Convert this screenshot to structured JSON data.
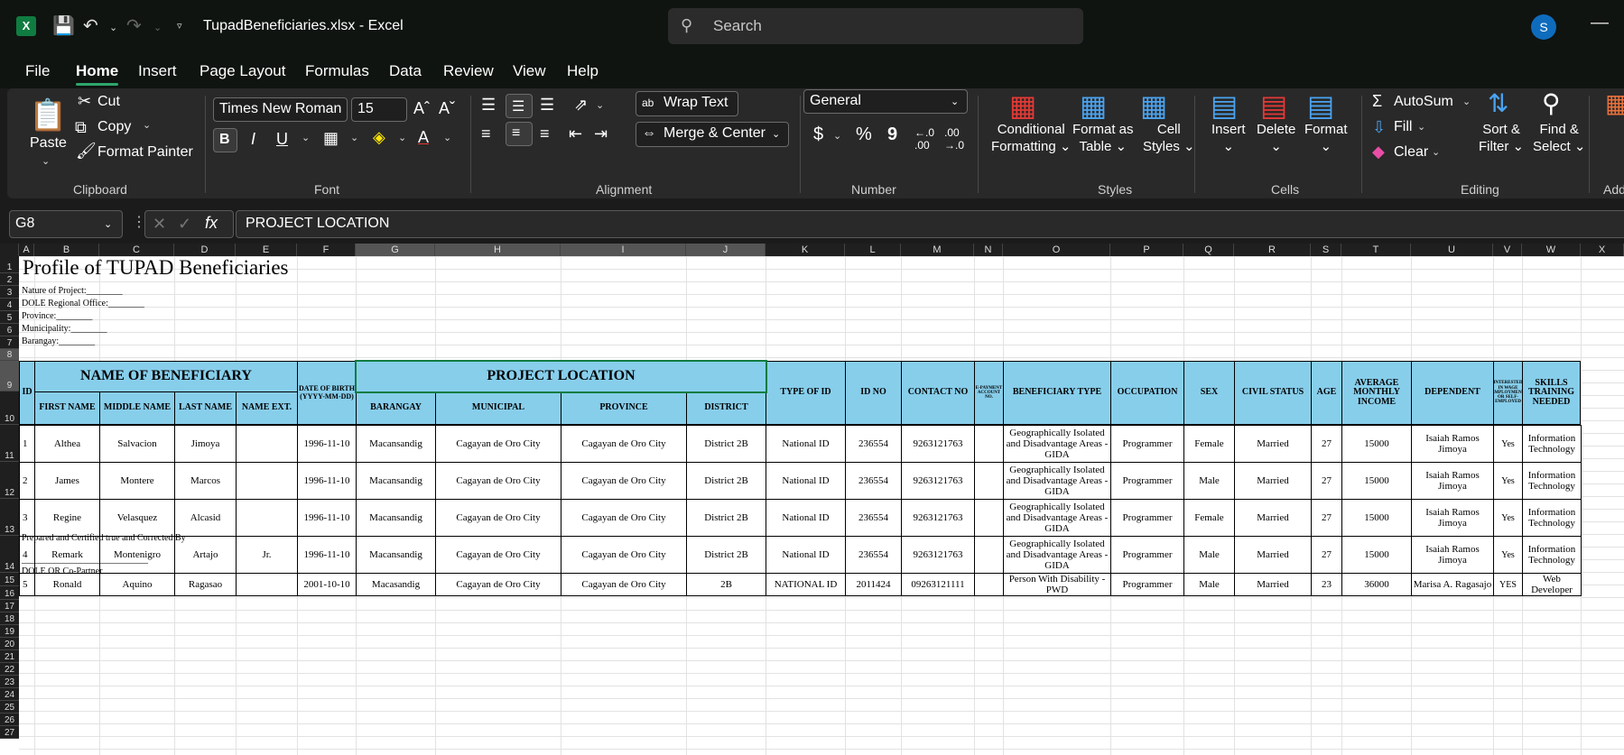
{
  "app": {
    "logo": "X",
    "doc_title": "TupadBeneficiaries.xlsx  -  Excel",
    "search_placeholder": "Search",
    "avatar": "S"
  },
  "menu": [
    "File",
    "Home",
    "Insert",
    "Page Layout",
    "Formulas",
    "Data",
    "Review",
    "View",
    "Help"
  ],
  "ribbon": {
    "clipboard": {
      "paste": "Paste",
      "cut": "Cut",
      "copy": "Copy",
      "format_painter": "Format Painter",
      "label": "Clipboard"
    },
    "font": {
      "name": "Times New Roman",
      "size": "15",
      "bold": "B",
      "italic": "I",
      "underline": "U",
      "label": "Font"
    },
    "alignment": {
      "wrap": "Wrap Text",
      "merge": "Merge & Center",
      "label": "Alignment"
    },
    "number": {
      "format": "General",
      "currency": "$",
      "percent": "%",
      "comma": "9",
      "label": "Number"
    },
    "styles": {
      "conditional": [
        "Conditional",
        "Formatting"
      ],
      "format_table": [
        "Format as",
        "Table"
      ],
      "cell_styles": [
        "Cell",
        "Styles"
      ],
      "label": "Styles"
    },
    "cells": {
      "insert": "Insert",
      "delete": "Delete",
      "format": "Format",
      "label": "Cells"
    },
    "editing": {
      "autosum": "AutoSum",
      "fill": "Fill",
      "clear": "Clear",
      "sort": [
        "Sort &",
        "Filter"
      ],
      "find": [
        "Find &",
        "Select"
      ],
      "label": "Editing"
    },
    "addins": {
      "label": "Add"
    }
  },
  "formula_bar": {
    "name_box": "G8",
    "fx": "fx",
    "content": "PROJECT LOCATION"
  },
  "columns": [
    "A",
    "B",
    "C",
    "D",
    "E",
    "F",
    "G",
    "H",
    "I",
    "J",
    "K",
    "L",
    "M",
    "N",
    "O",
    "P",
    "Q",
    "R",
    "S",
    "T",
    "U",
    "V",
    "W",
    "X"
  ],
  "rows": [
    "1",
    "2",
    "3",
    "4",
    "5",
    "6",
    "7",
    "8",
    "9",
    "10",
    "11",
    "12",
    "13",
    "14",
    "15",
    "16",
    "17",
    "18",
    "19",
    "20",
    "21",
    "22",
    "23",
    "24",
    "25",
    "26",
    "27"
  ],
  "sheet": {
    "title": "Profile of TUPAD Beneficiaries",
    "meta": [
      "Nature of Project:________",
      "DOLE Regional Office:________",
      "Province:________",
      "Municipality:________",
      "Barangay:________"
    ],
    "headers": {
      "id": "ID",
      "name": "NAME OF BENEFICIARY",
      "first": "FIRST NAME",
      "middle": "MIDDLE NAME",
      "last": "LAST NAME",
      "ext": "NAME EXT.",
      "dob": "DATE OF BIRTH (YYYY-MM-DD)",
      "location": "PROJECT LOCATION",
      "barangay": "BARANGAY",
      "municipal": "MUNICIPAL",
      "province": "PROVINCE",
      "district": "DISTRICT",
      "type_id": "TYPE OF ID",
      "id_no": "ID NO",
      "contact": "CONTACT NO",
      "epayment": "E-PAYMENT ACCOUNT NO.",
      "ben_type": "BENEFICIARY TYPE",
      "occupation": "OCCUPATION",
      "sex": "SEX",
      "civil": "CIVIL STATUS",
      "age": "AGE",
      "income": "AVERAGE MONTHLY INCOME",
      "dependent": "DEPENDENT",
      "interest": "INTERESTED IN WAGE EMPLOYMENT OR SELF-EMPLOYED",
      "skills": "SKILLS TRAINING NEEDED"
    },
    "data": [
      [
        "1",
        "Althea",
        "Salvacion",
        "Jimoya",
        "",
        "1996-11-10",
        "Macansandig",
        "Cagayan de Oro City",
        "Cagayan de Oro City",
        "District 2B",
        "National ID",
        "236554",
        "9263121763",
        "",
        "Geographically Isolated and Disadvantage Areas - GIDA",
        "Programmer",
        "Female",
        "Married",
        "27",
        "15000",
        "Isaiah Ramos Jimoya",
        "Yes",
        "Information Technology"
      ],
      [
        "2",
        "James",
        "Montere",
        "Marcos",
        "",
        "1996-11-10",
        "Macansandig",
        "Cagayan de Oro City",
        "Cagayan de Oro City",
        "District 2B",
        "National ID",
        "236554",
        "9263121763",
        "",
        "Geographically Isolated and Disadvantage Areas - GIDA",
        "Programmer",
        "Male",
        "Married",
        "27",
        "15000",
        "Isaiah Ramos Jimoya",
        "Yes",
        "Information Technology"
      ],
      [
        "3",
        "Regine",
        "Velasquez",
        "Alcasid",
        "",
        "1996-11-10",
        "Macansandig",
        "Cagayan de Oro City",
        "Cagayan de Oro City",
        "District 2B",
        "National ID",
        "236554",
        "9263121763",
        "",
        "Geographically Isolated and Disadvantage Areas - GIDA",
        "Programmer",
        "Female",
        "Married",
        "27",
        "15000",
        "Isaiah Ramos Jimoya",
        "Yes",
        "Information Technology"
      ],
      [
        "4",
        "Remark",
        "Montenigro",
        "Artajo",
        "Jr.",
        "1996-11-10",
        "Macansandig",
        "Cagayan de Oro City",
        "Cagayan de Oro City",
        "District 2B",
        "National ID",
        "236554",
        "9263121763",
        "",
        "Geographically Isolated and Disadvantage Areas - GIDA",
        "Programmer",
        "Male",
        "Married",
        "27",
        "15000",
        "Isaiah Ramos Jimoya",
        "Yes",
        "Information Technology"
      ],
      [
        "5",
        "Ronald",
        "Aquino",
        "Ragasao",
        "",
        "2001-10-10",
        "Macasandig",
        "Cagayan de Oro City",
        "Cagayan de Oro City",
        "2B",
        "NATIONAL ID",
        "2011424",
        "09263121111",
        "",
        "Person With Disability - PWD",
        "Programmer",
        "Male",
        "Married",
        "23",
        "36000",
        "Marisa A. Ragasajo",
        "YES",
        "Web Developer"
      ]
    ],
    "footer": {
      "prepared": "Prepared and Certified true and Corrected By",
      "line": "____________________________",
      "partner": "DOLE OR Co-Partner"
    }
  }
}
